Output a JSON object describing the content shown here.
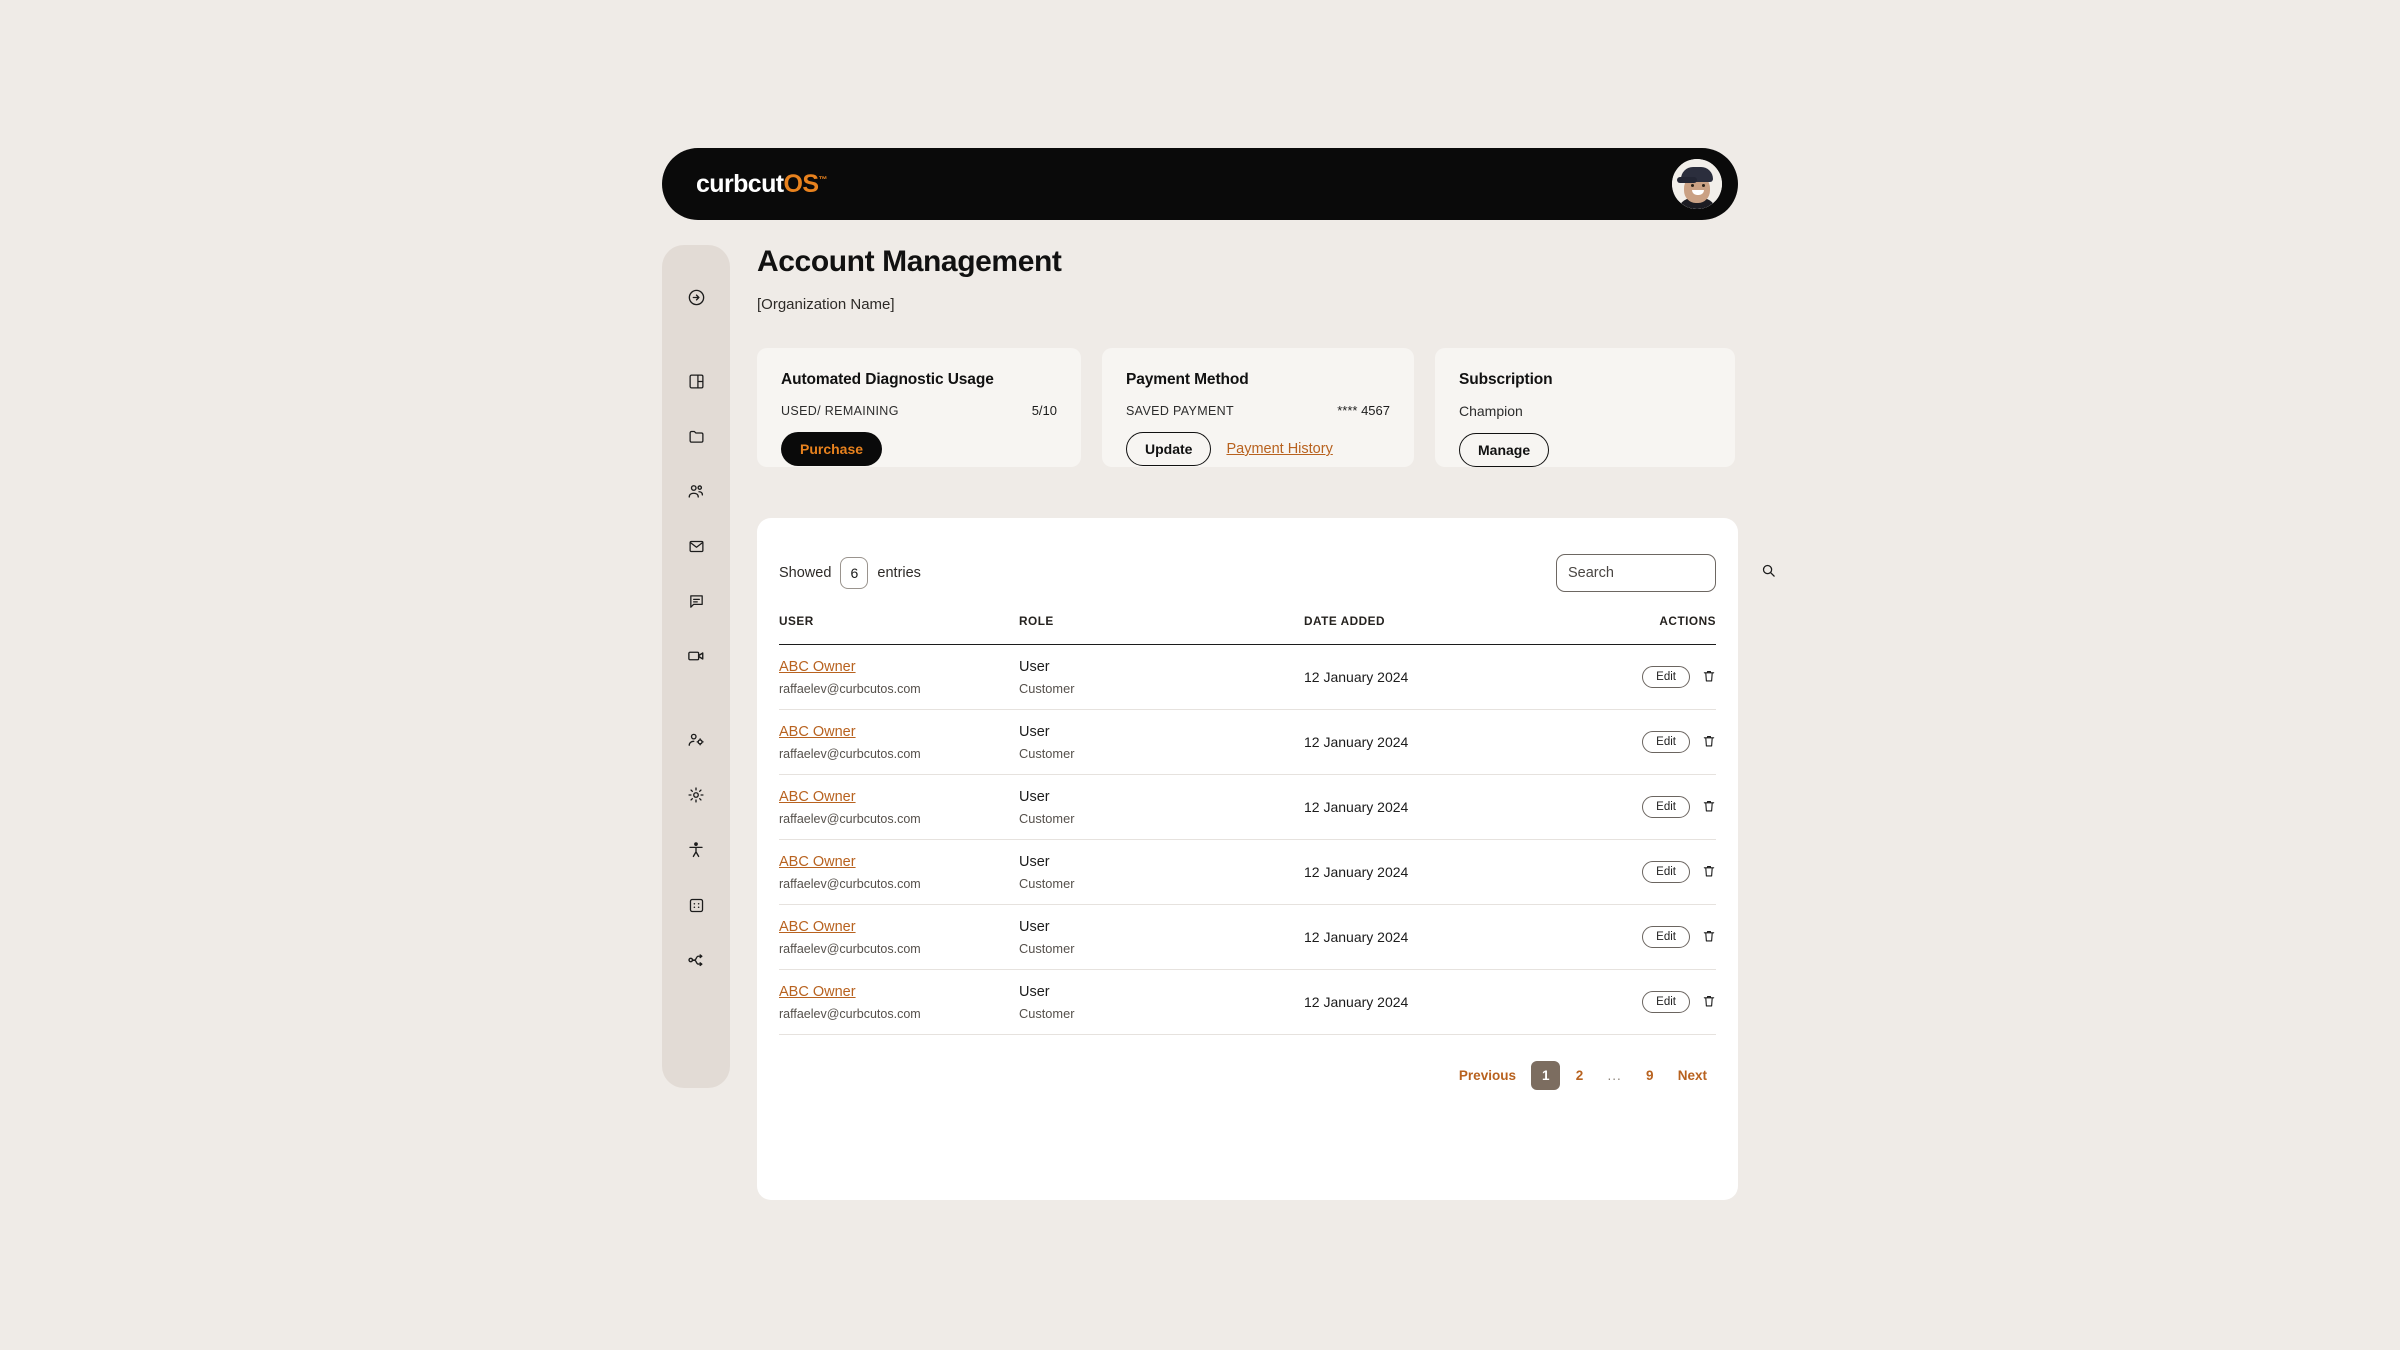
{
  "brand": {
    "name_dark": "curbcut",
    "name_accent": "OS",
    "trademark": "™",
    "accent_color": "#e8821e"
  },
  "header": {
    "avatar_label": "User avatar"
  },
  "sidebar": {
    "items": [
      {
        "name": "expand-sidebar",
        "icon": "arrow-right-circle-icon"
      },
      {
        "name": "dashboard",
        "icon": "layout-panel-icon"
      },
      {
        "name": "files",
        "icon": "folder-icon"
      },
      {
        "name": "people",
        "icon": "users-icon"
      },
      {
        "name": "mail",
        "icon": "envelope-icon"
      },
      {
        "name": "messages",
        "icon": "chat-icon"
      },
      {
        "name": "video",
        "icon": "video-camera-icon"
      },
      {
        "name": "user-settings",
        "icon": "user-gear-icon"
      },
      {
        "name": "settings",
        "icon": "gear-icon"
      },
      {
        "name": "accessibility",
        "icon": "accessibility-icon"
      },
      {
        "name": "apps",
        "icon": "grid-apps-icon"
      },
      {
        "name": "workflow",
        "icon": "flow-branch-icon"
      }
    ]
  },
  "page": {
    "title": "Account Management",
    "organization": "[Organization Name]"
  },
  "cards": {
    "diagnostic": {
      "title": "Automated Diagnostic Usage",
      "meta_label": "USED/ REMAINING",
      "meta_value": "5/10",
      "button": "Purchase"
    },
    "payment": {
      "title": "Payment Method",
      "meta_label": "SAVED PAYMENT",
      "meta_value": "**** 4567",
      "button": "Update",
      "link": "Payment History"
    },
    "subscription": {
      "title": "Subscription",
      "plan": "Champion",
      "button": "Manage"
    }
  },
  "table": {
    "showed_prefix": "Showed",
    "entries_count": "6",
    "showed_suffix": "entries",
    "search_placeholder": "Search",
    "search_value": "",
    "columns": [
      "USER",
      "ROLE",
      "DATE ADDED",
      "ACTIONS"
    ],
    "edit_label": "Edit",
    "delete_icon": "trash-icon",
    "rows": [
      {
        "user": "ABC Owner",
        "email": "raffaelev@curbcutos.com",
        "role": "User",
        "role_sub": "Customer",
        "date": "12 January 2024"
      },
      {
        "user": "ABC Owner",
        "email": "raffaelev@curbcutos.com",
        "role": "User",
        "role_sub": "Customer",
        "date": "12 January 2024"
      },
      {
        "user": "ABC Owner",
        "email": "raffaelev@curbcutos.com",
        "role": "User",
        "role_sub": "Customer",
        "date": "12 January 2024"
      },
      {
        "user": "ABC Owner",
        "email": "raffaelev@curbcutos.com",
        "role": "User",
        "role_sub": "Customer",
        "date": "12 January 2024"
      },
      {
        "user": "ABC Owner",
        "email": "raffaelev@curbcutos.com",
        "role": "User",
        "role_sub": "Customer",
        "date": "12 January 2024"
      },
      {
        "user": "ABC Owner",
        "email": "raffaelev@curbcutos.com",
        "role": "User",
        "role_sub": "Customer",
        "date": "12 January 2024"
      }
    ]
  },
  "pagination": {
    "previous": "Previous",
    "pages": [
      "1",
      "2",
      "...",
      "9"
    ],
    "active_page": "1",
    "next": "Next",
    "active_bg": "#7c6d60"
  },
  "colors": {
    "page_background": "#efebe7",
    "sidebar_background": "#e2dbd5",
    "card_background": "#f7f5f2",
    "table_background": "#ffffff",
    "accent_orange": "#e8821e",
    "link_brown": "#b8621f",
    "topbar_black": "#0a0a0a"
  }
}
